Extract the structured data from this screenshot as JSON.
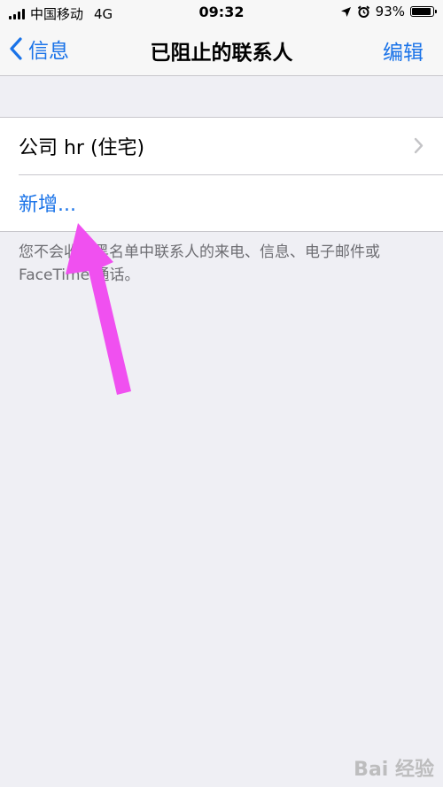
{
  "status_bar": {
    "carrier": "中国移动",
    "network": "4G",
    "time": "09:32",
    "battery_pct": "93%",
    "battery_level": 0.93
  },
  "nav": {
    "back_label": "信息",
    "title": "已阻止的联系人",
    "edit_label": "编辑"
  },
  "list": {
    "items": [
      {
        "label": "公司 hr (住宅)"
      }
    ],
    "add_label": "新增..."
  },
  "footnote": "您不会收到黑名单中联系人的来电、信息、电子邮件或 FaceTime 通话。",
  "watermark": "Bai 经验",
  "colors": {
    "accent": "#1a73e8",
    "arrow": "#f050f0"
  }
}
